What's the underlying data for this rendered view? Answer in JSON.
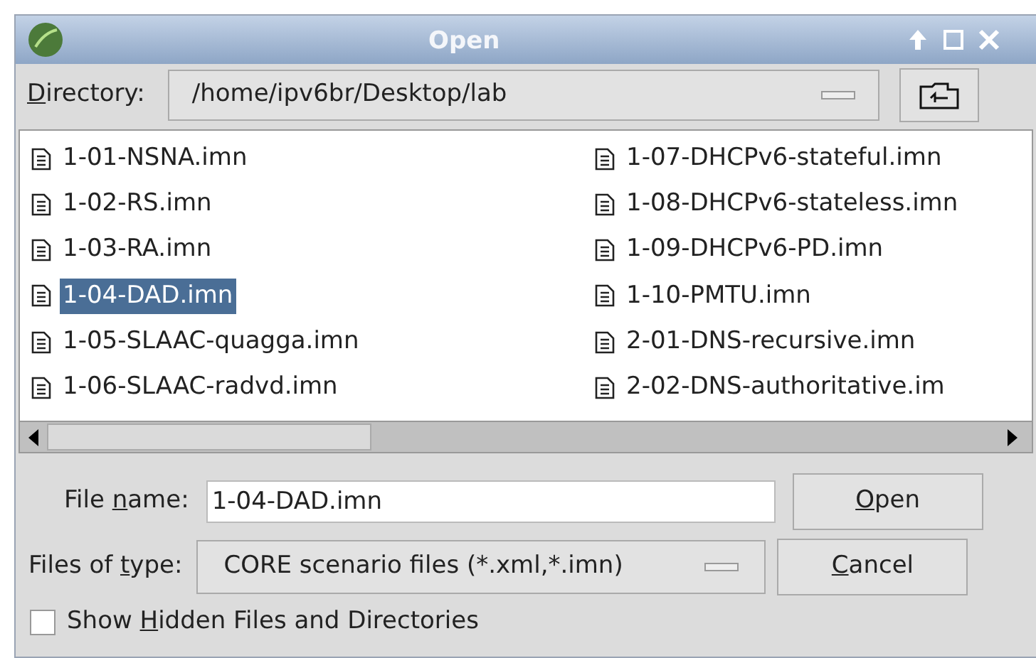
{
  "window": {
    "title": "Open"
  },
  "directory": {
    "label": {
      "key": "D",
      "rest": "irectory:"
    },
    "value": "/home/ipv6br/Desktop/lab"
  },
  "files": [
    {
      "name": "1-01-NSNA.imn",
      "selected": false
    },
    {
      "name": "1-02-RS.imn",
      "selected": false
    },
    {
      "name": "1-03-RA.imn",
      "selected": false
    },
    {
      "name": "1-04-DAD.imn",
      "selected": true
    },
    {
      "name": "1-05-SLAAC-quagga.imn",
      "selected": false
    },
    {
      "name": "1-06-SLAAC-radvd.imn",
      "selected": false
    },
    {
      "name": "1-07-DHCPv6-stateful.imn",
      "selected": false
    },
    {
      "name": "1-08-DHCPv6-stateless.imn",
      "selected": false
    },
    {
      "name": "1-09-DHCPv6-PD.imn",
      "selected": false
    },
    {
      "name": "1-10-PMTU.imn",
      "selected": false
    },
    {
      "name": "2-01-DNS-recursive.imn",
      "selected": false
    },
    {
      "name": "2-02-DNS-authoritative.im",
      "selected": false
    }
  ],
  "file_name": {
    "label": {
      "lead": "File ",
      "key": "n",
      "rest": "ame:"
    },
    "value": "1-04-DAD.imn"
  },
  "file_type": {
    "label": {
      "lead": "Files of ",
      "key": "t",
      "rest": "ype:"
    },
    "value": "CORE scenario files (*.xml,*.imn)"
  },
  "buttons": [
    {
      "key": "O",
      "rest": "pen"
    },
    {
      "key": "C",
      "rest": "ancel"
    }
  ],
  "show_hidden": {
    "label": {
      "lead": "Show ",
      "key": "H",
      "rest": "idden Files and Directories"
    },
    "checked": false
  }
}
